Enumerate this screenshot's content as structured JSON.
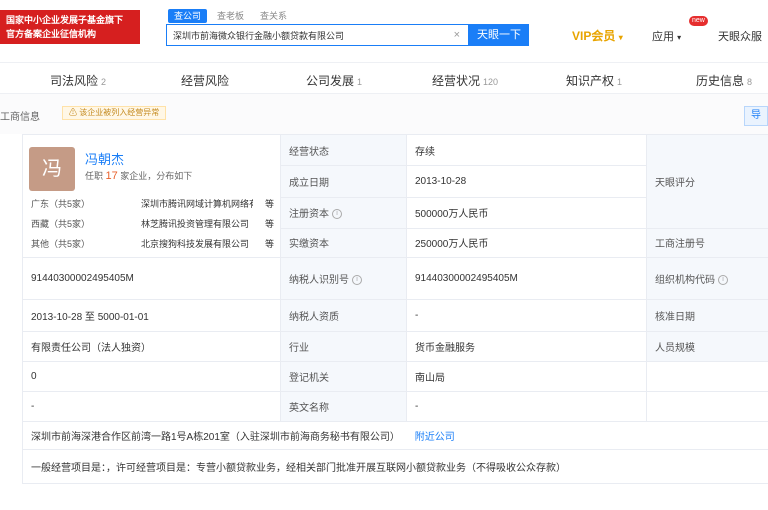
{
  "header": {
    "logo_line1": "国家中小企业发展子基金旗下",
    "logo_line2": "官方备案企业征信机构",
    "search_tabs": [
      "查公司",
      "查老板",
      "查关系"
    ],
    "search_value": "深圳市前海微众银行金融小额贷款有限公司",
    "search_button": "天眼一下",
    "vip_label": "VIP会员",
    "app_label": "应用",
    "new_badge": "new",
    "user_label": "天眼众服"
  },
  "nav": {
    "items": [
      {
        "label": "司法风险",
        "count": "2"
      },
      {
        "label": "经营风险",
        "count": ""
      },
      {
        "label": "公司发展",
        "count": "1"
      },
      {
        "label": "经营状况",
        "count": "120"
      },
      {
        "label": "知识产权",
        "count": "1"
      },
      {
        "label": "历史信息",
        "count": "8"
      }
    ]
  },
  "subbar": {
    "title": "工商信息",
    "notice": "该企业被列入经营异常",
    "side_button": "导"
  },
  "legal_rep": {
    "avatar_char": "冯",
    "name": "冯朝杰",
    "sub_prefix": "任职",
    "sub_count": "17",
    "sub_suffix": "家企业，分布如下",
    "regions": [
      {
        "name": "广东（共5家）",
        "company": "深圳市腾讯网域计算机网络有限公司",
        "more": "等"
      },
      {
        "name": "西藏（共5家）",
        "company": "林芝腾讯投资管理有限公司",
        "more": "等"
      },
      {
        "name": "其他（共5家）",
        "company": "北京搜狗科技发展有限公司",
        "more": "等"
      }
    ]
  },
  "table": {
    "status_label": "经营状态",
    "status_value": "存续",
    "tianyan_score_label": "天眼评分",
    "established_label": "成立日期",
    "established_value": "2013-10-28",
    "registered_capital_label": "注册资本",
    "registered_capital_value": "500000万人民币",
    "paid_capital_label": "实缴资本",
    "paid_capital_value": "250000万人民币",
    "reg_no_label": "工商注册号",
    "credit_code_value": "91440300002495405M",
    "taxpayer_id_label": "纳税人识别号",
    "taxpayer_id_value": "91440300002495405M",
    "org_code_label": "组织机构代码",
    "term_value": "2013-10-28 至 5000-01-01",
    "taxpayer_qual_label": "纳税人资质",
    "taxpayer_qual_value": "-",
    "approval_date_label": "核准日期",
    "company_type_value": "有限责任公司（法人独资）",
    "industry_label": "行业",
    "industry_value": "货币金融服务",
    "staff_size_label": "人员规模",
    "insured_value": "0",
    "authority_label": "登记机关",
    "authority_value": "南山局",
    "former_name_value": "-",
    "english_name_label": "英文名称",
    "english_name_value": "-",
    "address_value": "深圳市前海深港合作区前湾一路1号A栋201室（入驻深圳市前海商务秘书有限公司）",
    "nearby_link": "附近公司",
    "scope_value": "一般经营项目是：，许可经营项目是：专营小额贷款业务，经相关部门批准开展互联网小额贷款业务（不得吸收公众存款）"
  },
  "colors": {
    "brand_blue": "#1a7ef7",
    "logo_red": "#d61f1f",
    "vip_gold": "#e8a400",
    "accent_orange": "#e8612c",
    "label_bg": "#f5f8fc"
  }
}
